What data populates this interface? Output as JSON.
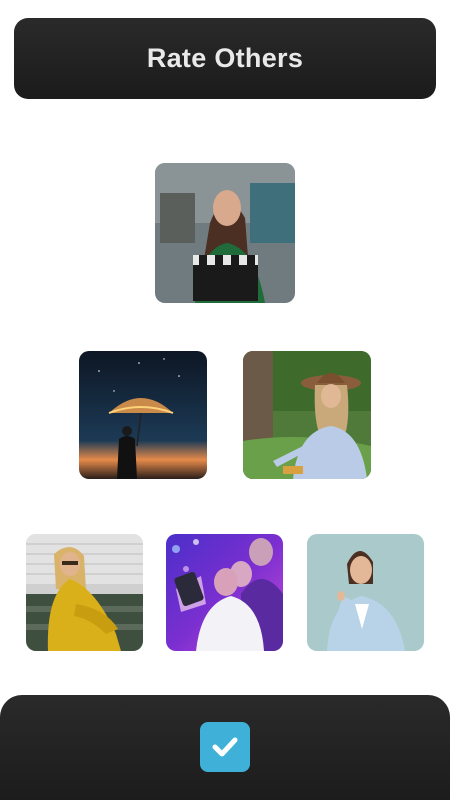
{
  "header": {
    "title": "Rate Others"
  },
  "photos": [
    {
      "id": "photo-top",
      "icon": "woman-with-clapperboard"
    },
    {
      "id": "photo-middle-left",
      "icon": "person-with-lit-umbrella-at-night"
    },
    {
      "id": "photo-middle-right",
      "icon": "woman-in-hat-on-grass"
    },
    {
      "id": "photo-bottom-left",
      "icon": "woman-in-yellow-dress-on-steps"
    },
    {
      "id": "photo-bottom-center",
      "icon": "women-taking-selfie-at-party"
    },
    {
      "id": "photo-bottom-right",
      "icon": "woman-in-blue-blazer-pointing"
    }
  ],
  "footer": {
    "confirm_icon": "checkmark-icon"
  },
  "colors": {
    "header_bg": "#1f1f1f",
    "header_text": "#e9e9e9",
    "footer_bg": "#222222",
    "confirm_button": "#3fb1d9",
    "page_bg": "#ffffff"
  }
}
